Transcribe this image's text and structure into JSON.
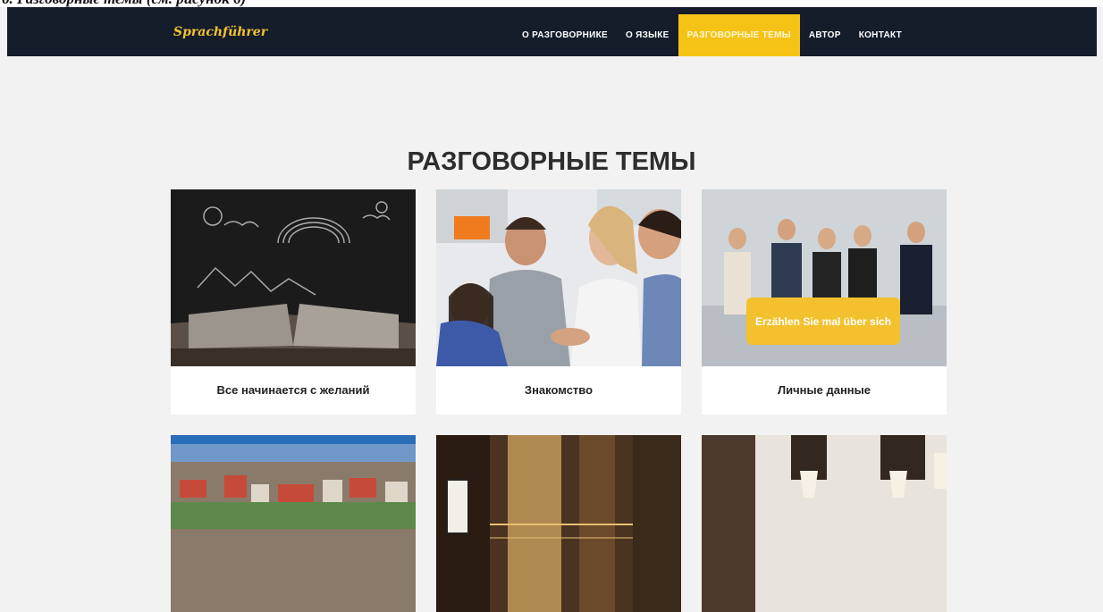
{
  "doc_caption": "6. Разговорные темы (см. рисунок 6)",
  "navbar": {
    "brand": "Sprachführer",
    "items": [
      {
        "label": "О РАЗГОВОРНИКЕ",
        "active": false
      },
      {
        "label": "О ЯЗЫКЕ",
        "active": false
      },
      {
        "label": "РАЗГОВОРНЫЕ ТЕМЫ",
        "active": true
      },
      {
        "label": "АВТОР",
        "active": false
      },
      {
        "label": "КОНТАКТ",
        "active": false
      }
    ],
    "colors": {
      "background": "#151c2a",
      "accent": "#f5c316",
      "brand": "#f1c232"
    }
  },
  "main": {
    "title": "РАЗГОВОРНЫЕ ТЕМЫ",
    "cards": [
      {
        "caption": "Все начинается с желаний",
        "image": "chalkboard-book-image"
      },
      {
        "caption": "Знакомство",
        "image": "handshake-people-image"
      },
      {
        "caption": "Личные данные",
        "image": "waiting-candidates-image",
        "overlay_label": "Erzählen Sie mal über sich"
      },
      {
        "caption": "",
        "image": "city-panorama-image"
      },
      {
        "caption": "",
        "image": "hotel-facade-image"
      },
      {
        "caption": "",
        "image": "restaurant-table-image"
      }
    ]
  }
}
